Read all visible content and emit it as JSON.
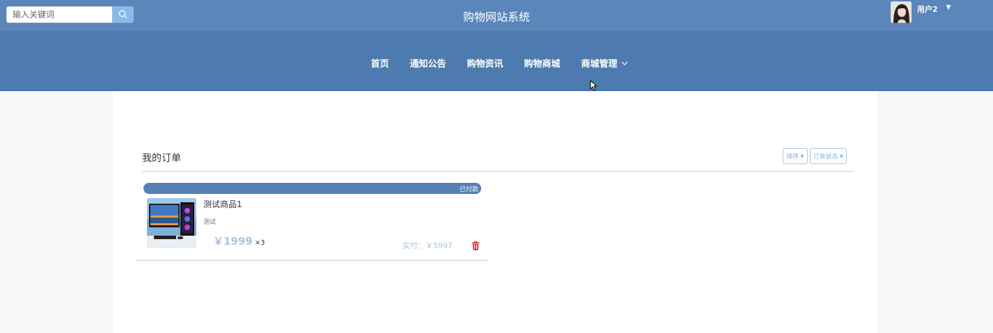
{
  "header": {
    "site_title": "购物网站系统",
    "search": {
      "placeholder": "输入关键词",
      "value": ""
    },
    "search_icon": "search-icon",
    "user": {
      "name": "用户2",
      "avatar": "user-avatar-photo",
      "caret_icon": "caret-down-icon"
    }
  },
  "nav": {
    "items": [
      {
        "label": "首页"
      },
      {
        "label": "通知公告"
      },
      {
        "label": "购物资讯"
      },
      {
        "label": "购物商城"
      },
      {
        "label": "商城管理",
        "icon": "chevron-down-icon"
      }
    ]
  },
  "orders": {
    "section_title": "我的订单",
    "filters": {
      "sort_label": "排序",
      "status_label": "订单状态"
    },
    "items": [
      {
        "status": "已付款",
        "product_name": "测试商品1",
        "description": "测试",
        "price": "￥1999",
        "quantity": "×3",
        "paid_total": "实付：￥5997",
        "image": "gaming-pc-photo",
        "delete_icon": "trash-icon"
      }
    ]
  },
  "colors": {
    "topbar": "#5a86ba",
    "navbar": "#4e7baf",
    "accent_light": "#a6c6e3",
    "status_bar": "#5580b3",
    "delete": "#e04040"
  }
}
